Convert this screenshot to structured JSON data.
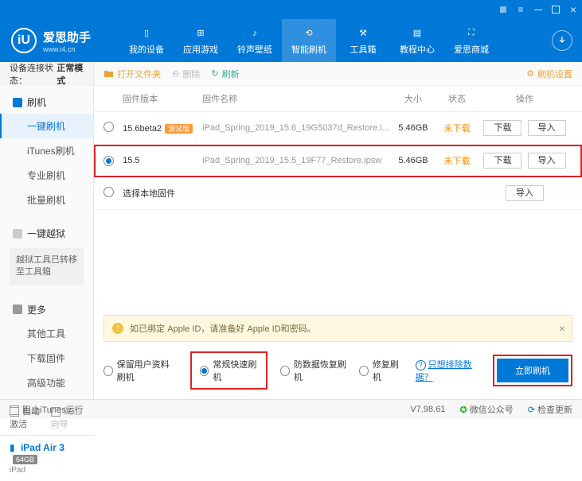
{
  "app": {
    "name": "爱思助手",
    "url": "www.i4.cn",
    "logo_letter": "iU"
  },
  "nav": {
    "items": [
      {
        "label": "我的设备",
        "icon": "phone"
      },
      {
        "label": "应用游戏",
        "icon": "apps"
      },
      {
        "label": "铃声壁纸",
        "icon": "music"
      },
      {
        "label": "智能刷机",
        "icon": "refresh"
      },
      {
        "label": "工具箱",
        "icon": "toolbox"
      },
      {
        "label": "教程中心",
        "icon": "book"
      },
      {
        "label": "爱思商城",
        "icon": "cart"
      }
    ],
    "active_index": 3
  },
  "sidebar": {
    "status_label": "设备连接状态：",
    "status_value": "正常模式",
    "groups": [
      {
        "head": "刷机",
        "items": [
          "一键刷机",
          "iTunes刷机",
          "专业刷机",
          "批量刷机"
        ],
        "active": 0
      },
      {
        "head": "一键越狱",
        "note": "越狱工具已转移至工具箱"
      },
      {
        "head": "更多",
        "items": [
          "其他工具",
          "下载固件",
          "高级功能"
        ]
      }
    ],
    "checks": {
      "auto_activate": "自动激活",
      "skip_guide": "跳过向导"
    },
    "device": {
      "name": "iPad Air 3",
      "storage": "64GB",
      "model": "iPad"
    }
  },
  "toolbar": {
    "open_folder": "打开文件夹",
    "delete": "删除",
    "refresh": "刷新",
    "settings": "刷机设置"
  },
  "table": {
    "cols": {
      "version": "固件版本",
      "name": "固件名称",
      "size": "大小",
      "status": "状态",
      "ops": "操作"
    },
    "rows": [
      {
        "version": "15.6beta2",
        "beta": "测试版",
        "name": "iPad_Spring_2019_15.6_19G5037d_Restore.i...",
        "size": "5.46GB",
        "status": "未下载",
        "selected": false
      },
      {
        "version": "15.5",
        "name": "iPad_Spring_2019_15.5_19F77_Restore.ipsw",
        "size": "5.46GB",
        "status": "未下载",
        "selected": true,
        "highlight": true
      }
    ],
    "local_fw": "选择本地固件",
    "btn_download": "下载",
    "btn_import": "导入"
  },
  "warning": {
    "text": "如已绑定 Apple ID，请准备好 Apple ID和密码。"
  },
  "modes": {
    "opts": [
      "保留用户资料刷机",
      "常规快速刷机",
      "防数据恢复刷机",
      "修复刷机"
    ],
    "selected": 1,
    "exclude_link": "只想排除数据？",
    "flash_btn": "立即刷机"
  },
  "footer": {
    "block_itunes": "阻止iTunes运行",
    "version": "V7.98.61",
    "wechat": "微信公众号",
    "check_update": "检查更新"
  }
}
